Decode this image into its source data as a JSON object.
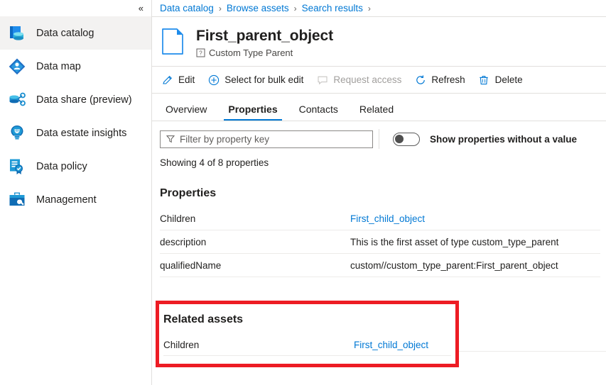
{
  "sidebar": {
    "collapse_label": "«",
    "items": [
      {
        "label": "Data catalog",
        "icon": "data-catalog-icon",
        "selected": true
      },
      {
        "label": "Data map",
        "icon": "data-map-icon",
        "selected": false
      },
      {
        "label": "Data share (preview)",
        "icon": "data-share-icon",
        "selected": false
      },
      {
        "label": "Data estate insights",
        "icon": "data-estate-insights-icon",
        "selected": false
      },
      {
        "label": "Data policy",
        "icon": "data-policy-icon",
        "selected": false
      },
      {
        "label": "Management",
        "icon": "management-icon",
        "selected": false
      }
    ]
  },
  "breadcrumb": {
    "items": [
      "Data catalog",
      "Browse assets",
      "Search results"
    ],
    "separator": "›",
    "trailing_separator": "›"
  },
  "asset": {
    "title": "First_parent_object",
    "type_label": "Custom Type Parent",
    "type_icon": "unknown-type-icon",
    "doc_icon": "document-icon"
  },
  "toolbar": {
    "buttons": [
      {
        "label": "Edit",
        "icon": "pencil-icon",
        "disabled": false
      },
      {
        "label": "Select for bulk edit",
        "icon": "plus-circle-icon",
        "disabled": false
      },
      {
        "label": "Request access",
        "icon": "comment-icon",
        "disabled": true
      },
      {
        "label": "Refresh",
        "icon": "refresh-icon",
        "disabled": false
      },
      {
        "label": "Delete",
        "icon": "trash-icon",
        "disabled": false
      }
    ]
  },
  "tabs": [
    {
      "label": "Overview",
      "active": false
    },
    {
      "label": "Properties",
      "active": true
    },
    {
      "label": "Contacts",
      "active": false
    },
    {
      "label": "Related",
      "active": false
    }
  ],
  "filter": {
    "placeholder": "Filter by property key",
    "value": "",
    "icon": "filter-icon"
  },
  "toggle": {
    "label": "Show properties without a value",
    "state": "off"
  },
  "showing": "Showing 4 of 8 properties",
  "properties": {
    "heading": "Properties",
    "rows": [
      {
        "key": "Children",
        "value": "First_child_object",
        "is_link": true
      },
      {
        "key": "description",
        "value": "This is the first asset of type custom_type_parent",
        "is_link": false
      },
      {
        "key": "qualifiedName",
        "value": "custom//custom_type_parent:First_parent_object",
        "is_link": false
      }
    ]
  },
  "related_assets": {
    "heading": "Related assets",
    "rows": [
      {
        "key": "Children",
        "value": "First_child_object",
        "is_link": true
      }
    ],
    "highlight_color": "#ed1c24"
  },
  "colors": {
    "accent": "#0078d4",
    "link": "#0078d4",
    "highlight": "#ed1c24",
    "sidebar_selected": "#f3f2f1",
    "border": "#e1dfdd"
  }
}
